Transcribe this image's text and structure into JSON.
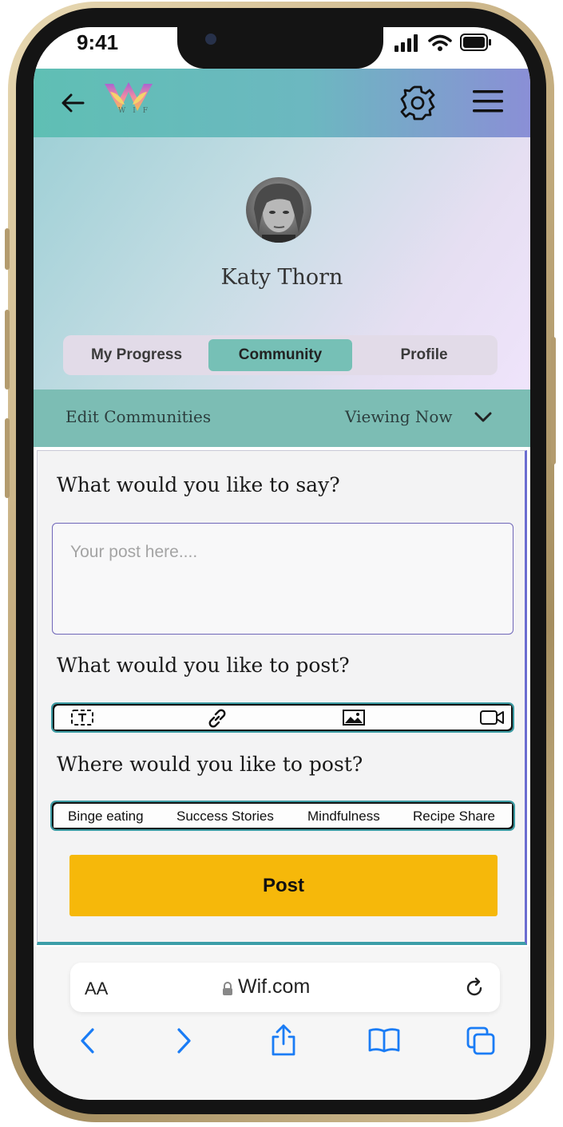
{
  "status_bar": {
    "time": "9:41"
  },
  "header": {
    "logo_letters": "WIF",
    "back_icon": "arrow-left-icon",
    "settings_icon": "gear-icon",
    "menu_icon": "hamburger-icon"
  },
  "profile": {
    "name": "Katy Thorn"
  },
  "tabs": [
    {
      "label": "My Progress",
      "active": false
    },
    {
      "label": "Community",
      "active": true
    },
    {
      "label": "Profile",
      "active": false
    }
  ],
  "community_bar": {
    "left_label": "Edit Communities",
    "right_label": "Viewing Now"
  },
  "composer": {
    "prompt_say": "What would you like to say?",
    "placeholder": "Your post here....",
    "prompt_post": "What would you like to post?",
    "post_types": [
      "text-icon",
      "link-icon",
      "image-icon",
      "video-icon"
    ],
    "prompt_where": "Where would you like to post?",
    "locations": [
      "Binge eating",
      "Success Stories",
      "Mindfulness",
      "Recipe Share"
    ],
    "post_button": "Post"
  },
  "browser": {
    "text_size_label": "AA",
    "url": "Wif.com",
    "nav_icons": [
      "chevron-left-icon",
      "chevron-right-icon",
      "share-icon",
      "bookmarks-icon",
      "tabs-icon"
    ]
  },
  "colors": {
    "accent_teal": "#7cbdb4",
    "post_button": "#f6b80a",
    "ios_blue": "#1a7cf5"
  }
}
